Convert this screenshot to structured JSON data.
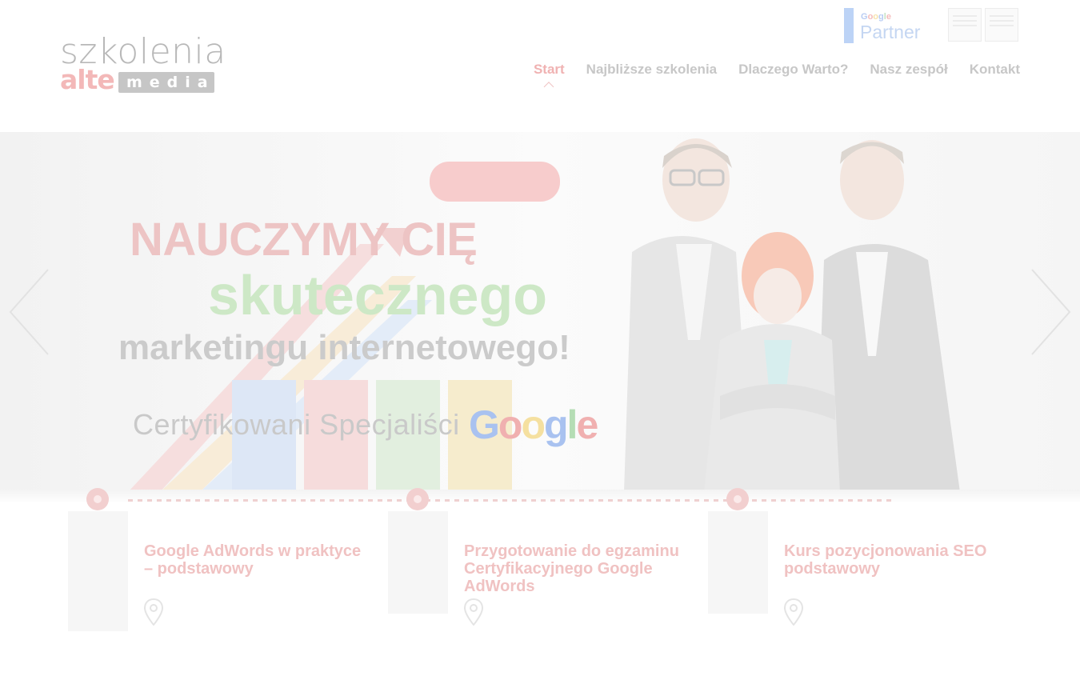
{
  "logo": {
    "top": "szkolenia",
    "alte": "alte",
    "media": "media"
  },
  "partner": {
    "brand_letters": [
      "G",
      "o",
      "o",
      "g",
      "l",
      "e"
    ],
    "brand_colors": [
      "#b9cdf3",
      "#f4bcbc",
      "#f7e3ad",
      "#b9cdf3",
      "#c5e3c5",
      "#f4bcbc"
    ],
    "word": "Partner"
  },
  "nav": {
    "items": [
      {
        "label": "Start",
        "active": true
      },
      {
        "label": "Najbliższe szkolenia",
        "active": false
      },
      {
        "label": "Dlaczego Warto?",
        "active": false
      },
      {
        "label": "Nasz zespół",
        "active": false
      },
      {
        "label": "Kontakt",
        "active": false
      }
    ]
  },
  "hero": {
    "line1": "NAUCZYMY CIĘ",
    "line2": "skutecznego",
    "line3": "marketingu internetowego!",
    "certified": "Certyfikowani Specjaliści",
    "google_letters": [
      "G",
      "o",
      "o",
      "g",
      "l",
      "e"
    ],
    "google_colors": [
      "#a9c2f0",
      "#f0b0b0",
      "#f5e0a0",
      "#a9c2f0",
      "#b5ddb5",
      "#f0b0b0"
    ]
  },
  "cards": [
    {
      "title": "Google AdWords w praktyce – podstawowy"
    },
    {
      "title": "Przygotowanie do egzaminu Certyfikacyjnego Google AdWords"
    },
    {
      "title": "Kurs pozycjonowania SEO podstawowy"
    }
  ],
  "colors": {
    "accent": "#e25c5c",
    "google_blue": "#4285f4",
    "green": "#59b84c"
  }
}
